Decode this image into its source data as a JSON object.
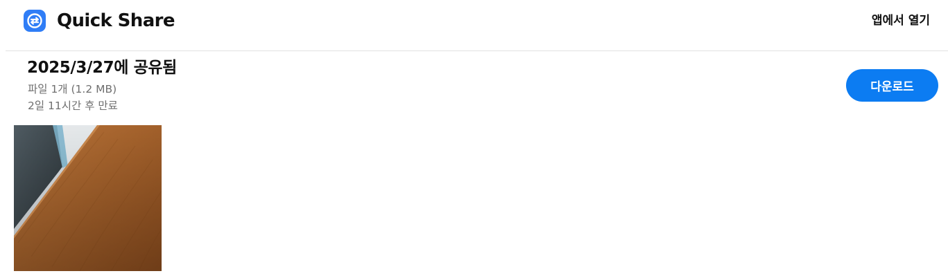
{
  "header": {
    "app_name": "Quick Share",
    "logo_icon": "quick-share-logo-icon",
    "open_in_app_label": "앱에서 열기"
  },
  "share": {
    "title": "2025/3/27에 공유됨",
    "files_summary": "파일 1개 (1.2 MB)",
    "expiry": "2일 11시간 후 만료",
    "download_label": "다운로드"
  },
  "thumbnail": {
    "icon": "photo-thumbnail"
  },
  "colors": {
    "accent": "#0c7cf2",
    "logo": "#2f7df6",
    "secondary_text": "#6f6f6f",
    "divider": "#e2e2e2"
  }
}
